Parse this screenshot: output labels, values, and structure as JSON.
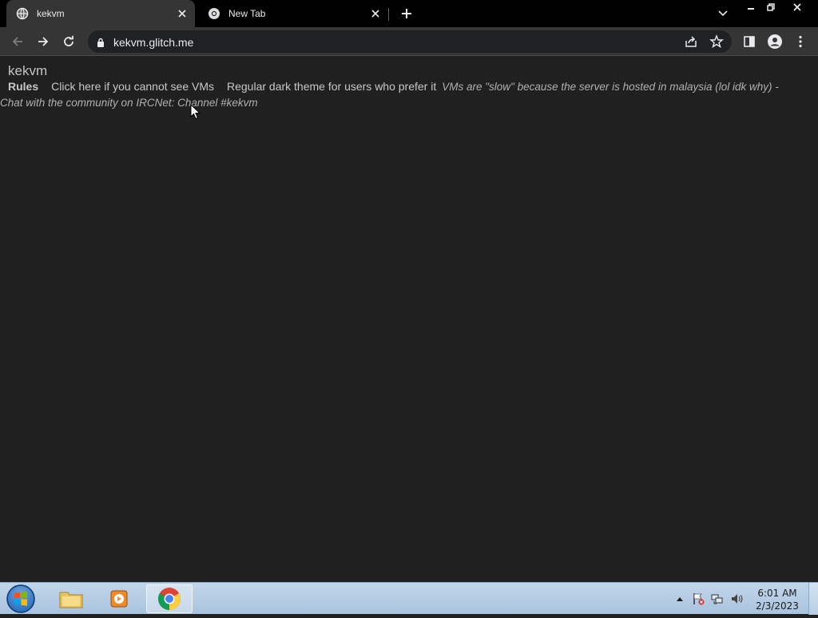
{
  "browser": {
    "tabs": [
      {
        "title": "kekvm",
        "active": true
      },
      {
        "title": "New Tab",
        "active": false
      }
    ],
    "address": "kekvm.glitch.me"
  },
  "page": {
    "site_title": "kekvm",
    "nav": {
      "rules": "Rules",
      "cannot_see": "Click here if you cannot see VMs",
      "dark_theme": "Regular dark theme for users who prefer it"
    },
    "notice_line1": "VMs are \"slow\" because the server is hosted in malaysia (lol idk why) -",
    "notice_line2": "Chat with the community on IRCNet: Channel #kekvm"
  },
  "taskbar": {
    "time": "6:01 AM",
    "date": "2/3/2023"
  },
  "colors": {
    "page_bg": "#202020",
    "toolbar_bg": "#353535",
    "tabstrip_bg": "#000000"
  }
}
